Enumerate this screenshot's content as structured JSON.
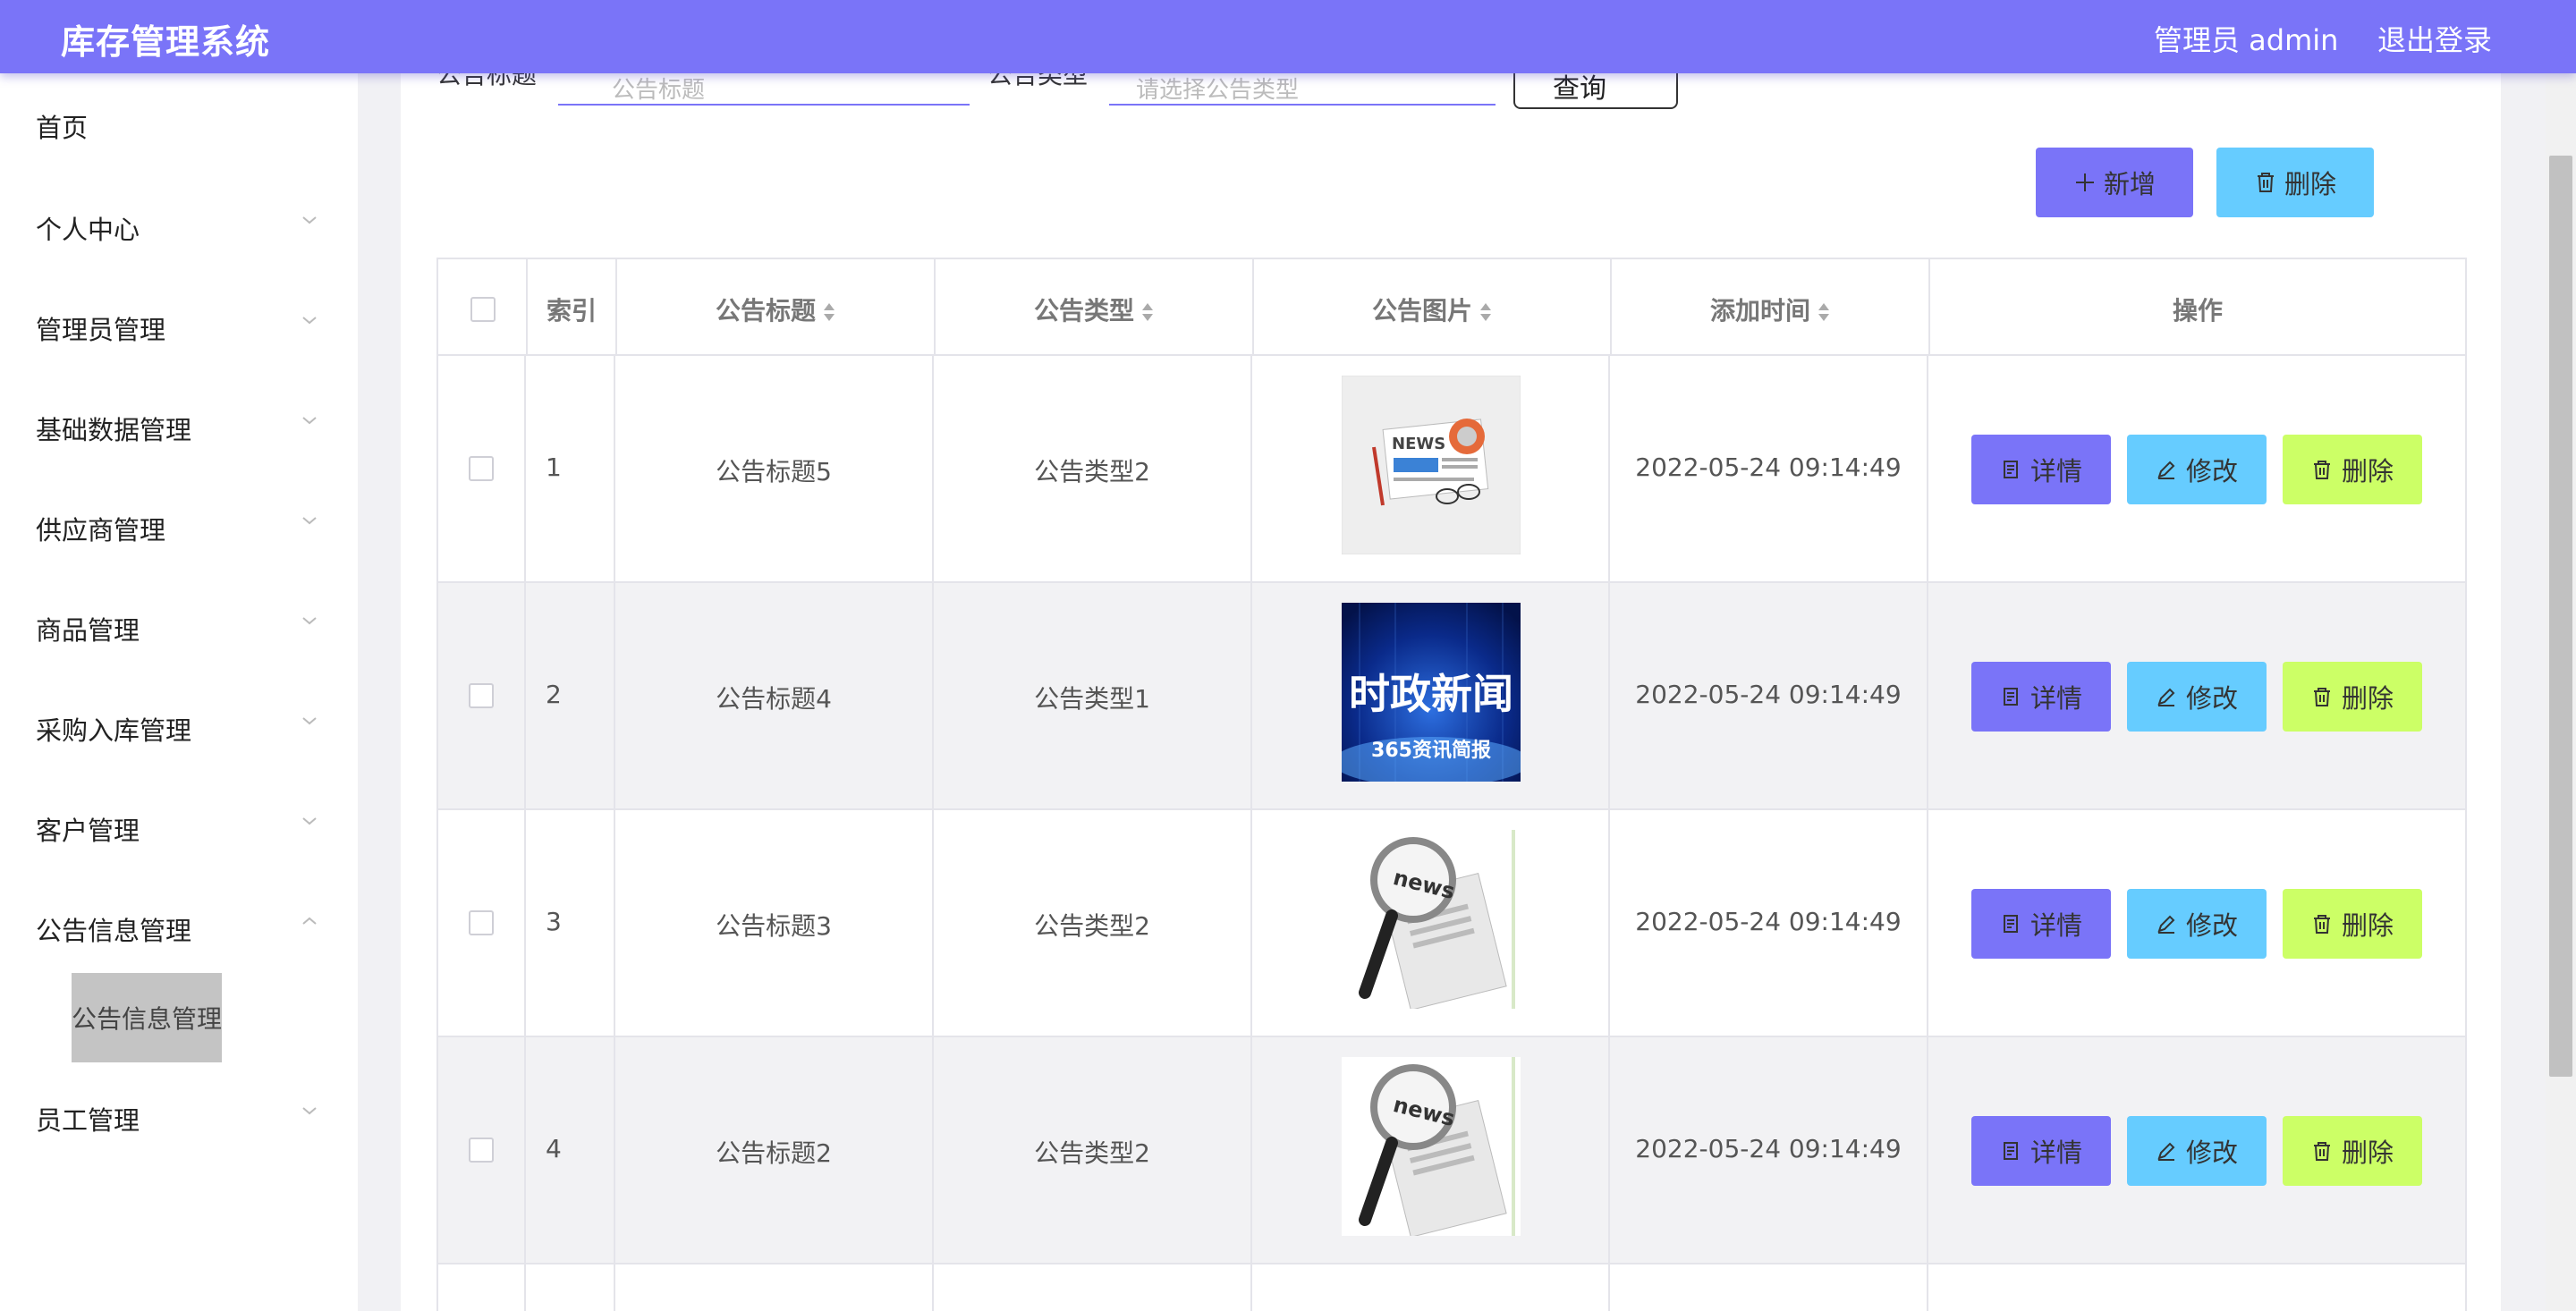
{
  "app": {
    "title": "库存管理系统",
    "user": "管理员 admin",
    "logout": "退出登录"
  },
  "sidebar": {
    "items": [
      {
        "label": "首页"
      },
      {
        "label": "个人中心"
      },
      {
        "label": "管理员管理"
      },
      {
        "label": "基础数据管理"
      },
      {
        "label": "供应商管理"
      },
      {
        "label": "商品管理"
      },
      {
        "label": "采购入库管理"
      },
      {
        "label": "客户管理"
      },
      {
        "label": "公告信息管理"
      },
      {
        "label": "员工管理"
      }
    ],
    "sub_active": "公告信息管理"
  },
  "search": {
    "title_label": "公告标题",
    "title_placeholder": "公告标题",
    "type_label": "公告类型",
    "type_placeholder": "请选择公告类型",
    "query_label": "查询"
  },
  "toolbar": {
    "add_label": "新增",
    "delete_label": "删除"
  },
  "table": {
    "headers": [
      "索引",
      "公告标题",
      "公告类型",
      "公告图片",
      "添加时间",
      "操作"
    ],
    "rows": [
      {
        "index": "1",
        "title": "公告标题5",
        "type": "公告类型2",
        "image": "news-paper-image",
        "time": "2022-05-24 09:14:49"
      },
      {
        "index": "2",
        "title": "公告标题4",
        "type": "公告类型1",
        "image": "shizheng-news-image",
        "time": "2022-05-24 09:14:49"
      },
      {
        "index": "3",
        "title": "公告标题3",
        "type": "公告类型2",
        "image": "news-magnifier-image",
        "time": "2022-05-24 09:14:49"
      },
      {
        "index": "4",
        "title": "公告标题2",
        "type": "公告类型2",
        "image": "news-magnifier-image",
        "time": "2022-05-24 09:14:49"
      }
    ],
    "actions": {
      "detail": "详情",
      "edit": "修改",
      "delete": "删除"
    }
  },
  "images": {
    "shizheng_text": "时政新闻",
    "shizheng_sub": "365资讯简报",
    "news_word": "NEWS",
    "news_word_lower": "news"
  },
  "colors": {
    "header": "#7a74f8",
    "detail_btn": "#7a74f8",
    "edit_btn": "#66ccff",
    "delete_btn": "#ccff66"
  }
}
